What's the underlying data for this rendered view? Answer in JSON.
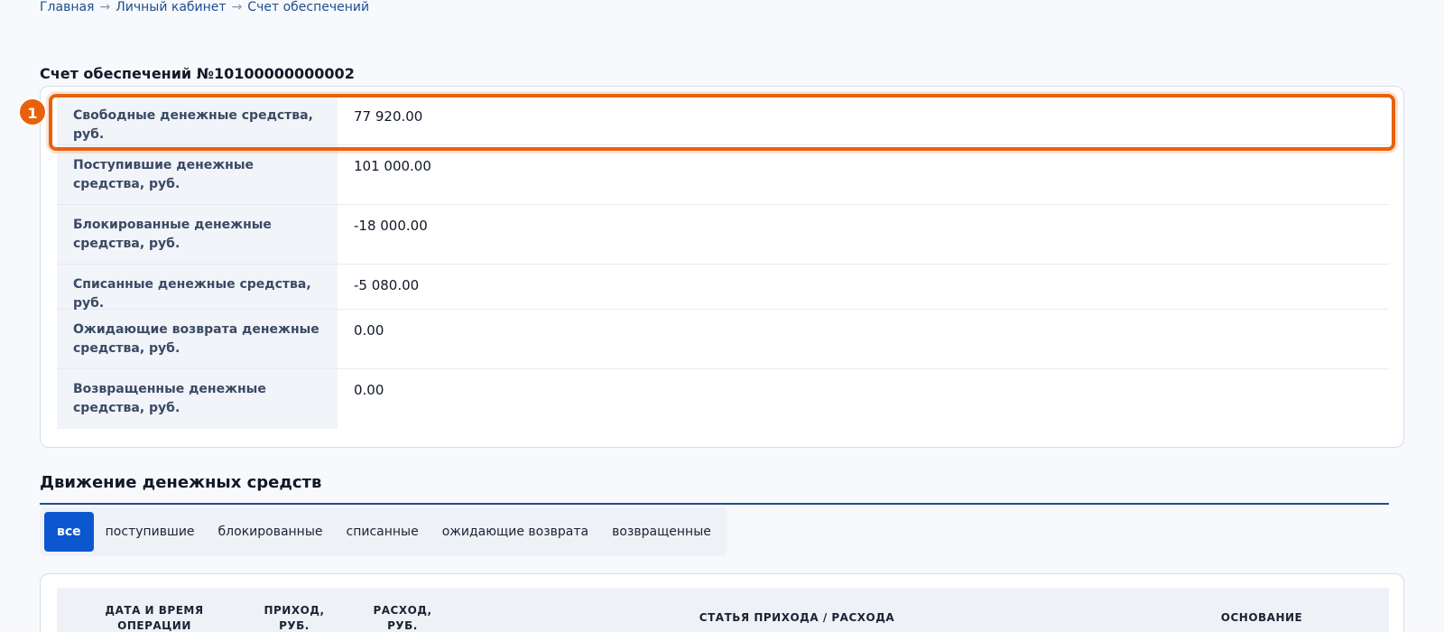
{
  "breadcrumb": {
    "home": "Главная",
    "cabinet": "Личный кабинет",
    "current": "Счет обеспечений",
    "separator": "→"
  },
  "account": {
    "title": "Счет обеспечений №10100000000002",
    "rows": [
      {
        "label": "Свободные денежные средства, руб.",
        "value": "77 920.00"
      },
      {
        "label": "Поступившие денежные средства, руб.",
        "value": "101 000.00"
      },
      {
        "label": "Блокированные денежные средства, руб.",
        "value": "-18 000.00"
      },
      {
        "label": "Списанные денежные средства, руб.",
        "value": "-5 080.00"
      },
      {
        "label": "Ожидающие возврата денежные средства, руб.",
        "value": "0.00"
      },
      {
        "label": "Возвращенные денежные средства, руб.",
        "value": "0.00"
      }
    ]
  },
  "annotation": {
    "marker": "1",
    "color": "#e8620e"
  },
  "movements": {
    "title": "Движение денежных средств",
    "filters": [
      "все",
      "поступившие",
      "блокированные",
      "списанные",
      "ожидающие возврата",
      "возвращенные"
    ],
    "active_filter": "все",
    "columns": [
      "ДАТА И ВРЕМЯ ОПЕРАЦИИ",
      "ПРИХОД, РУБ.",
      "РАСХОД, РУБ.",
      "СТАТЬЯ ПРИХОДА / РАСХОДА",
      "ОСНОВАНИЕ"
    ]
  },
  "colors": {
    "accent": "#0b57d0",
    "highlight": "#e8620e",
    "link": "#1d4f8f"
  }
}
